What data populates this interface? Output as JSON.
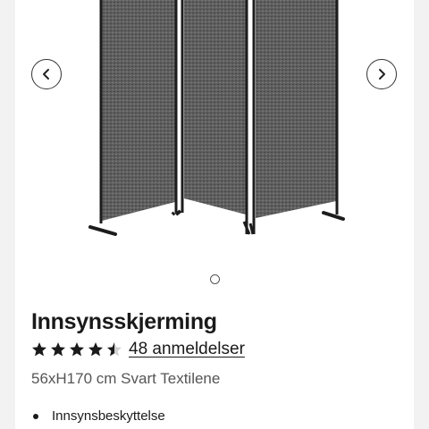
{
  "product": {
    "title": "Innsynsskjerming",
    "rating": 4.5,
    "rating_max": 5,
    "reviews_link": "48 anmeldelser",
    "subtitle": "56xH170 cm Svart Textilene",
    "features": [
      "Innsynsbeskyttelse"
    ]
  },
  "gallery": {
    "image_count": 1,
    "active_index": 0,
    "prev_icon": "chevron-left-icon",
    "next_icon": "chevron-right-icon"
  },
  "colors": {
    "star_filled": "#1a1a1a",
    "star_empty": "#d0d0d0",
    "panel_fabric": "#5a5a5a",
    "frame": "#1c1c1c"
  }
}
